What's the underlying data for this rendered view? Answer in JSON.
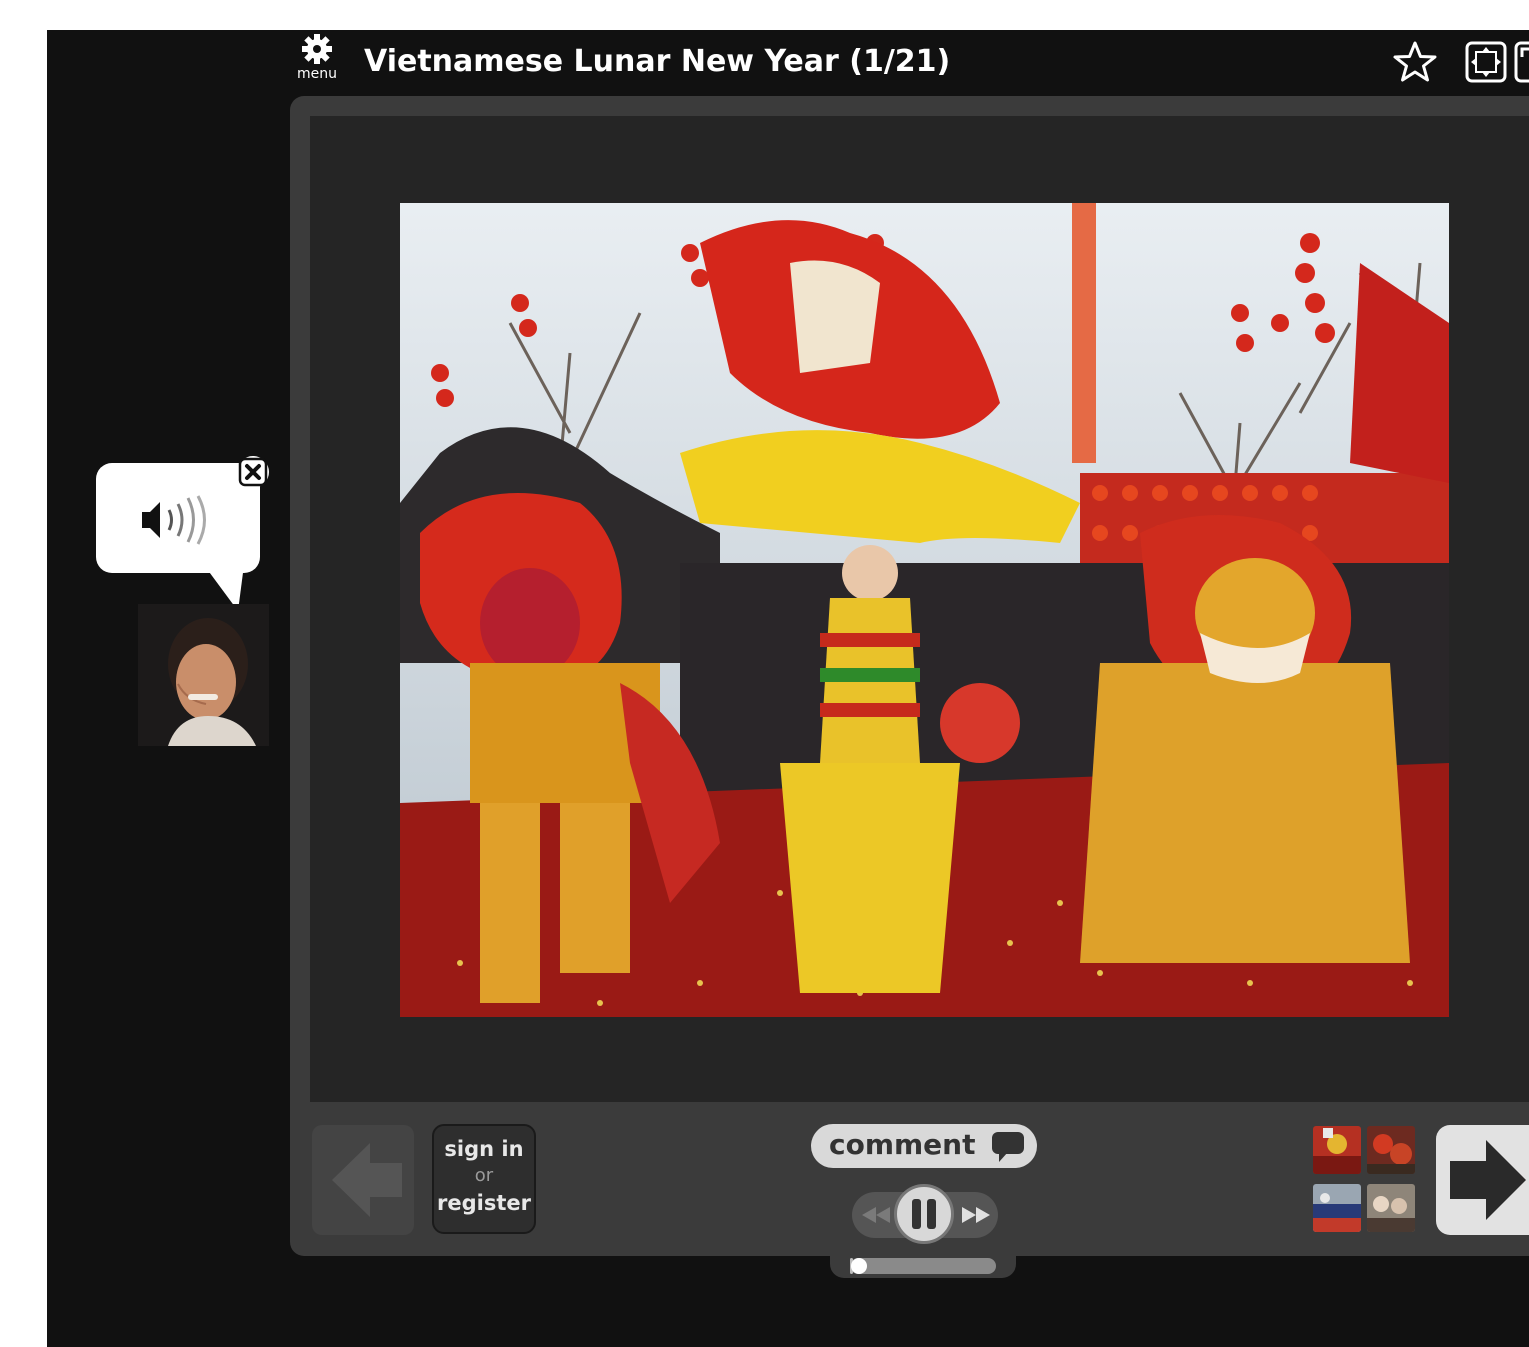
{
  "header": {
    "menu_label": "menu",
    "title": "Vietnamese Lunar New Year (1/21)",
    "menu_icon": "gear-icon",
    "favorite_icon": "star-icon",
    "fit_icon": "fit-screen-icon",
    "fullscreen_icon": "fullscreen-icon"
  },
  "viewer": {
    "photo_subject": "photo-lion-dance",
    "prev_icon": "arrow-left-icon",
    "next_icon": "arrow-right-icon"
  },
  "controls": {
    "sign_in": "sign in",
    "or": "or",
    "register": "register",
    "comment": "comment",
    "comment_icon": "speech-bubble-icon",
    "rewind_icon": "rewind-icon",
    "pause_icon": "pause-icon",
    "forward_icon": "fast-forward-icon",
    "progress": 0.02
  },
  "thumbnails": [
    {
      "name": "thumbnail-1"
    },
    {
      "name": "thumbnail-2"
    },
    {
      "name": "thumbnail-3"
    },
    {
      "name": "thumbnail-4"
    }
  ],
  "narrator": {
    "audio_icon": "speaker-icon",
    "close_icon": "close-icon"
  },
  "colors": {
    "background": "#111111",
    "panel": "#3b3b3b",
    "photo_frame": "#252525",
    "text": "#ffffff"
  }
}
